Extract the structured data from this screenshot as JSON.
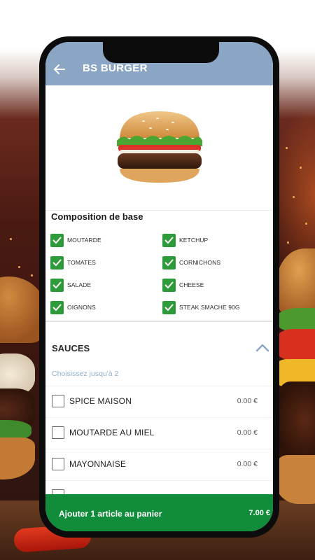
{
  "app": {
    "title": "BS BURGER",
    "back_icon": "arrow-left-icon"
  },
  "product": {
    "image": "burger-image"
  },
  "composition": {
    "title": "Composition de base",
    "items": [
      {
        "label": "MOUTARDE",
        "checked": true
      },
      {
        "label": "KETCHUP",
        "checked": true
      },
      {
        "label": "TOMATES",
        "checked": true
      },
      {
        "label": "CORNICHONS",
        "checked": true
      },
      {
        "label": "SALADE",
        "checked": true
      },
      {
        "label": "CHEESE",
        "checked": true
      },
      {
        "label": "OIGNONS",
        "checked": true
      },
      {
        "label": "STEAK SMACHE 90G",
        "checked": true
      }
    ]
  },
  "sauces": {
    "title": "SAUCES",
    "collapse_icon": "chevron-up-icon",
    "hint": "Choisissez jusqu'à 2",
    "options": [
      {
        "label": "SPICE MAISON",
        "price": "0.00 €",
        "checked": false
      },
      {
        "label": "MOUTARDE AU MIEL",
        "price": "0.00 €",
        "checked": false
      },
      {
        "label": "MAYONNAISE",
        "price": "0.00 €",
        "checked": false
      }
    ]
  },
  "cart": {
    "label": "Ajouter 1 article au panier",
    "price": "7.00 €"
  },
  "colors": {
    "appbar": "#8ba6c4",
    "check": "#2e9b3a",
    "cta": "#118c3a",
    "hint": "#8fb0cc"
  }
}
